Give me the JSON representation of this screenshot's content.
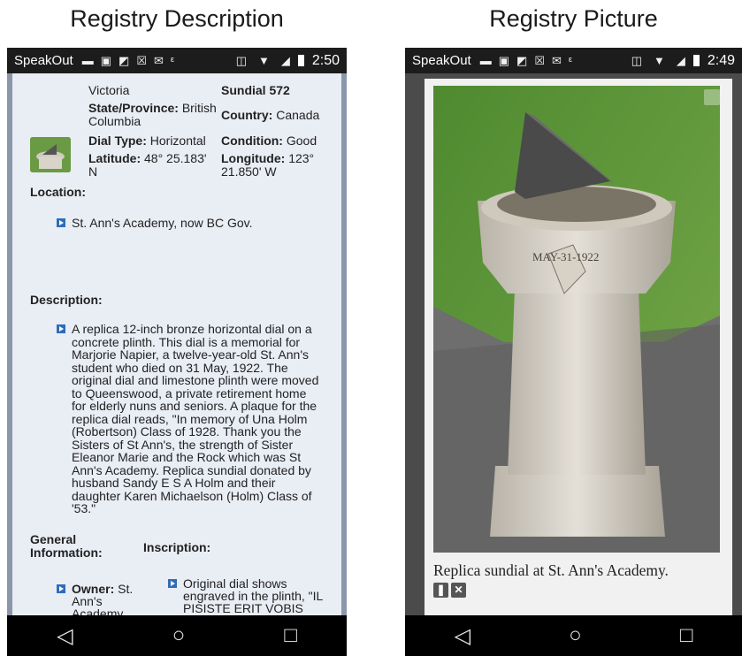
{
  "left_panel": {
    "caption": "Registry Description",
    "status": {
      "app": "SpeakOut",
      "time": "2:50"
    },
    "fields": {
      "city": "Victoria",
      "sundial": "Sundial 572",
      "state_label": "State/Province:",
      "state_value": "British Columbia",
      "country_label": "Country:",
      "country_value": "Canada",
      "dial_type_label": "Dial Type:",
      "dial_type_value": "Horizontal",
      "condition_label": "Condition:",
      "condition_value": "Good",
      "latitude_label": "Latitude:",
      "latitude_value": "48° 25.183' N",
      "longitude_label": "Longitude:",
      "longitude_value": "123° 21.850' W"
    },
    "location_heading": "Location:",
    "location_text": "St. Ann's Academy, now BC Gov.",
    "description_heading": "Description:",
    "description_text": "A replica 12-inch bronze horizontal dial on a concrete plinth. This dial is a memorial for Marjorie Napier, a twelve-year-old St. Ann's student who died on 31 May, 1922. The original dial and limestone plinth were moved to Queenswood, a private retirement home for elderly nuns and seniors. A plaque for the replica dial reads, \"In memory of Una Holm (Robertson) Class of 1928. Thank you the Sisters of St Ann's, the strength of Sister Eleanor Marie and the Rock which was St Ann's Academy. Replica sundial donated by husband Sandy E S A Holm and their daughter Karen Michaelson (Holm) Class of '53.\"",
    "general_heading": "General Information:",
    "inscription_heading": "Inscription:",
    "owner_label": "Owner:",
    "owner_value": "St. Ann's Academy, now BC Government",
    "inscription_text": "Original dial shows engraved in the plinth, \"IL PISISTE ERIT VOBIS TESTEMONIUM.\" Engraved cross and"
  },
  "right_panel": {
    "caption": "Registry Picture",
    "status": {
      "app": "SpeakOut",
      "time": "2:49"
    },
    "photo_caption": "Replica sundial at St. Ann's Academy.",
    "photo_inscription": "MAY-31-1922"
  },
  "icons": [
    "message-icon",
    "image-icon",
    "picture-icon",
    "close-box-icon",
    "mail-icon",
    "vibrate-icon",
    "wifi-icon",
    "signal-icon",
    "battery-icon",
    "back-icon",
    "home-icon",
    "recents-icon",
    "expand-icon",
    "pin-icon",
    "close-icon"
  ],
  "colors": {
    "status_bar": "#1c1c1c",
    "nav_bar": "#000000",
    "sheet_bg": "#e9edf4",
    "bullet": "#2e6db8",
    "grass": "#5e8d3d"
  }
}
